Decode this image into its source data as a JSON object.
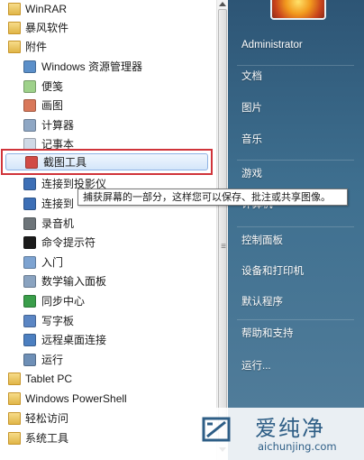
{
  "left_items": [
    {
      "label": "WinRAR",
      "icon": "folder-icon",
      "kind": "folder"
    },
    {
      "label": "暴风软件",
      "icon": "folder-icon",
      "kind": "folder"
    },
    {
      "label": "附件",
      "icon": "folder-open-icon",
      "kind": "folder"
    },
    {
      "label": "Windows 资源管理器",
      "icon": "explorer-icon",
      "kind": "app",
      "color": "#5b8fc9"
    },
    {
      "label": "便笺",
      "icon": "sticky-notes-icon",
      "kind": "app",
      "color": "#9ed18a"
    },
    {
      "label": "画图",
      "icon": "paint-icon",
      "kind": "app",
      "color": "#d9785a"
    },
    {
      "label": "计算器",
      "icon": "calculator-icon",
      "kind": "app",
      "color": "#8fa7c4"
    },
    {
      "label": "记事本",
      "icon": "notepad-icon",
      "kind": "app",
      "color": "#cfd9e6"
    },
    {
      "label": "截图工具",
      "icon": "snipping-tool-icon",
      "kind": "app",
      "color": "#d14a45"
    },
    {
      "label": "连接到投影仪",
      "icon": "projector-icon",
      "kind": "app",
      "color": "#3d6fb6"
    },
    {
      "label": "连接到",
      "icon": "network-icon",
      "kind": "app",
      "color": "#3d6fb6"
    },
    {
      "label": "录音机",
      "icon": "microphone-icon",
      "kind": "app",
      "color": "#6d7479"
    },
    {
      "label": "命令提示符",
      "icon": "cmd-icon",
      "kind": "app",
      "color": "#1b1b1b"
    },
    {
      "label": "入门",
      "icon": "getting-started-icon",
      "kind": "app",
      "color": "#7da3d1"
    },
    {
      "label": "数学输入面板",
      "icon": "math-input-icon",
      "kind": "app",
      "color": "#8aa3c0"
    },
    {
      "label": "同步中心",
      "icon": "sync-center-icon",
      "kind": "app",
      "color": "#3a9e4a"
    },
    {
      "label": "写字板",
      "icon": "wordpad-icon",
      "kind": "app",
      "color": "#5b86c4"
    },
    {
      "label": "远程桌面连接",
      "icon": "remote-desktop-icon",
      "kind": "app",
      "color": "#4c7fc0"
    },
    {
      "label": "运行",
      "icon": "run-icon",
      "kind": "app",
      "color": "#6e8fb6"
    },
    {
      "label": "Tablet PC",
      "icon": "folder-icon",
      "kind": "folder"
    },
    {
      "label": "Windows PowerShell",
      "icon": "folder-icon",
      "kind": "folder"
    },
    {
      "label": "轻松访问",
      "icon": "folder-icon",
      "kind": "folder"
    },
    {
      "label": "系统工具",
      "icon": "folder-icon",
      "kind": "folder"
    }
  ],
  "tooltip": "捕获屏幕的一部分，这样您可以保存、批注或共享图像。",
  "right_items": [
    {
      "label": "Administrator"
    },
    {
      "label": "文档"
    },
    {
      "label": "图片"
    },
    {
      "label": "音乐"
    },
    {
      "label": "游戏"
    },
    {
      "label": "计算机"
    },
    {
      "label": "控制面板"
    },
    {
      "label": "设备和打印机"
    },
    {
      "label": "默认程序"
    },
    {
      "label": "帮助和支持"
    },
    {
      "label": "运行..."
    }
  ],
  "watermark": {
    "title": "爱纯净",
    "url": "aichunjing.com"
  },
  "colors": {
    "highlight_border": "#d0343a",
    "sidebar_top": "#2d5575",
    "sidebar_bottom": "#547f9c"
  }
}
